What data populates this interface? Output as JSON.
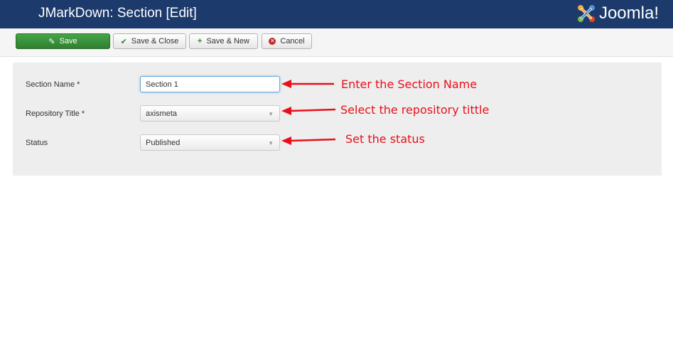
{
  "header": {
    "title": "JMarkDown: Section [Edit]",
    "logo_text": "Joomla!"
  },
  "toolbar": {
    "save_label": "Save",
    "save_close_label": "Save & Close",
    "save_new_label": "Save & New",
    "cancel_label": "Cancel"
  },
  "form": {
    "section_name": {
      "label": "Section Name *",
      "value": "Section 1"
    },
    "repository_title": {
      "label": "Repository Title *",
      "value": "axismeta"
    },
    "status": {
      "label": "Status",
      "value": "Published"
    }
  },
  "annotations": {
    "section_name": "Enter the Section Name",
    "repository": "Select the repository tittle",
    "status": "Set the status"
  },
  "colors": {
    "header_bg": "#1c3a6b",
    "save_green": "#3a943a",
    "annotation_red": "#e8101a"
  }
}
